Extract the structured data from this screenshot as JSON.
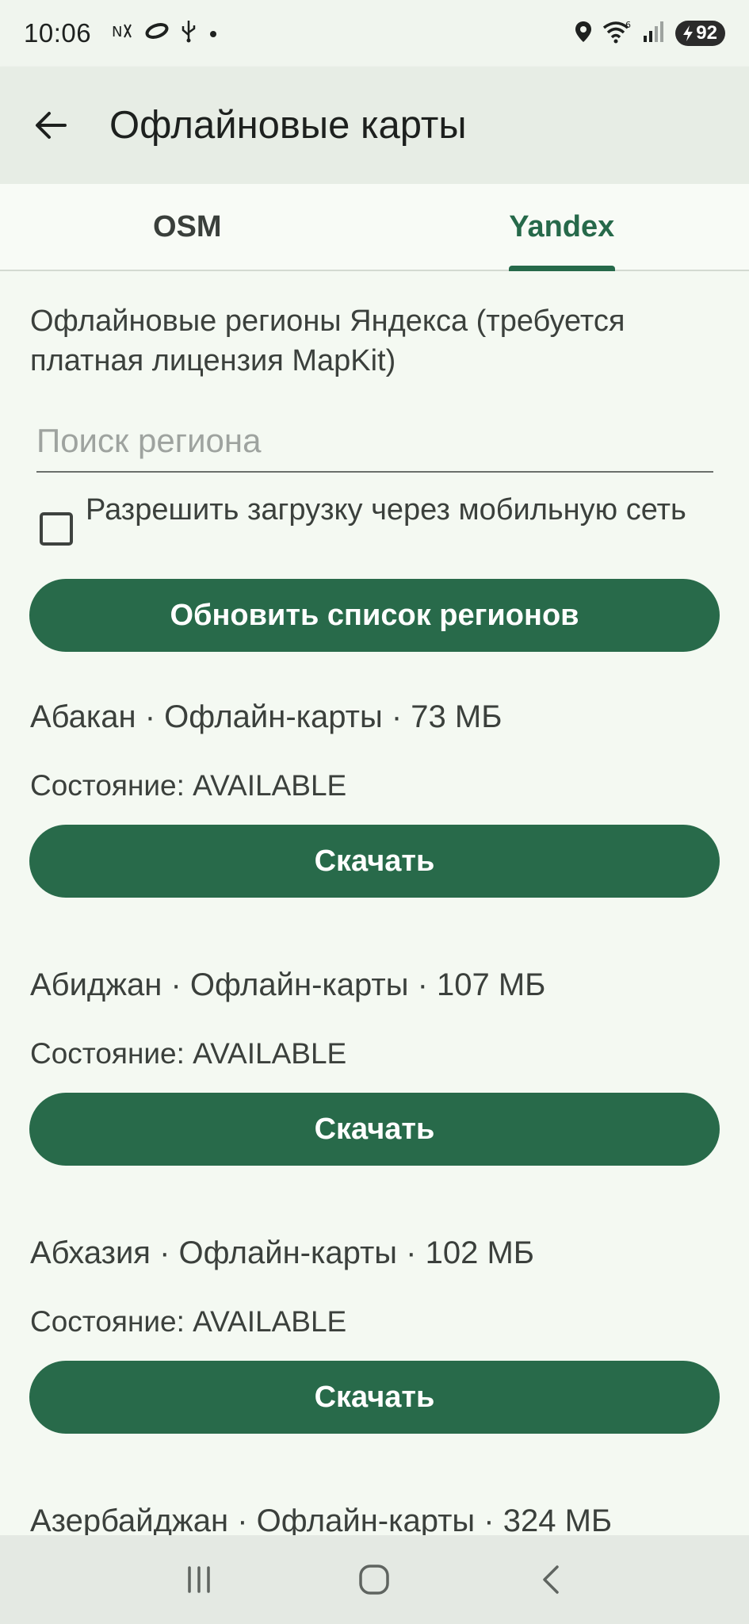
{
  "status_bar": {
    "time": "10:06",
    "battery": "92"
  },
  "app_bar": {
    "title": "Офлайновые карты"
  },
  "tabs": [
    {
      "label": "OSM",
      "active": false
    },
    {
      "label": "Yandex",
      "active": true
    }
  ],
  "intro_text": "Офлайновые регионы Яндекса (требуется платная лицензия MapKit)",
  "search": {
    "placeholder": "Поиск региона",
    "value": ""
  },
  "mobile_network": {
    "label": "Разрешить загрузку через мобильную сеть",
    "checked": false
  },
  "refresh_button": "Обновить список регионов",
  "regions": [
    {
      "title": "Абакан · Офлайн-карты · 73 МБ",
      "state": "Состояние: AVAILABLE",
      "button": "Скачать"
    },
    {
      "title": "Абиджан · Офлайн-карты · 107 МБ",
      "state": "Состояние: AVAILABLE",
      "button": "Скачать"
    },
    {
      "title": "Абхазия · Офлайн-карты · 102 МБ",
      "state": "Состояние: AVAILABLE",
      "button": "Скачать"
    },
    {
      "title": "Азербайджан · Офлайн-карты · 324 МБ"
    }
  ],
  "colors": {
    "primary": "#286a4a",
    "background": "#f4f9f2",
    "app_bar": "#e7ede5"
  }
}
